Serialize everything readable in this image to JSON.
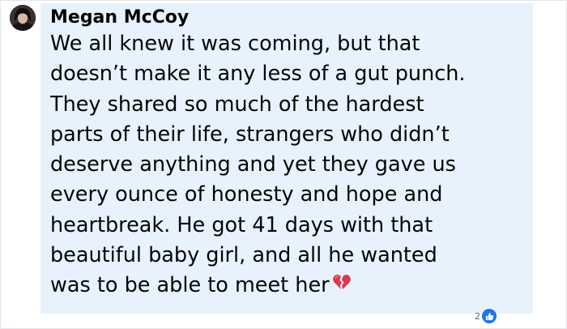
{
  "comment": {
    "author": "Megan McCoy",
    "lines": [
      "We all knew it was coming, but that",
      "doesn’t make it any less of a gut punch.",
      "They shared so much of the hardest",
      "parts of their life, strangers who didn’t",
      "deserve anything and yet they gave us",
      "every ounce of honesty and hope and",
      "heartbreak. He got 41 days with that",
      "beautiful baby girl, and all he wanted",
      "was to be able to meet her"
    ],
    "trailing_emoji": "broken-heart-icon",
    "reaction_count": "2",
    "reaction_type": "like-icon"
  },
  "colors": {
    "bubble_bg": "#e8f2fd",
    "text": "#050505",
    "like_blue": "#1877f2",
    "broken_heart": "#e0344b"
  }
}
